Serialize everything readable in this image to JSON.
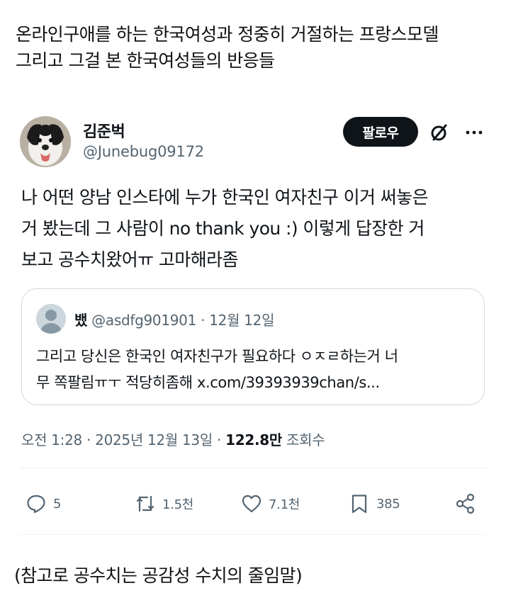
{
  "post_title": {
    "line1": "온라인구애를 하는 한국여성과 정중히 거절하는 프랑스모델",
    "line2": "그리고 그걸 본 한국여성들의 반응들"
  },
  "tweet": {
    "author": {
      "name": "김준벅",
      "handle": "@Junebug09172"
    },
    "follow_label": "팔로우",
    "body_lines": [
      "나 어떤 양남 인스타에 누가 한국인 여자친구 이거 써놓은",
      "거 봤는데 그 사람이 no thank you :) 이렇게 답장한 거",
      "보고 공수치왔어ㅠ 고마해라좀"
    ],
    "quote": {
      "name": "뱄",
      "handle": "@asdfg901901",
      "separator": "·",
      "date": "12월 12일",
      "text_lines": [
        "그리고 당신은 한국인 여자친구가 필요하다 ㅇㅈㄹ하는거 너",
        "무 쪽팔림ㅠㅜ 적당히좀해 x.com/39393939chan/s..."
      ]
    },
    "timestamp": "오전 1:28 · 2025년 12월 13일 · ",
    "views_count": "122.8만",
    "views_label": " 조회수",
    "actions": {
      "replies": "5",
      "reposts": "1.5천",
      "likes": "7.1천",
      "bookmarks": "385"
    },
    "icons": [
      "grok-icon",
      "more-icon",
      "reply-icon",
      "repost-icon",
      "like-icon",
      "bookmark-icon",
      "share-icon"
    ]
  },
  "footer_note": "(참고로 공수치는 공감성 수치의 줄임말)"
}
